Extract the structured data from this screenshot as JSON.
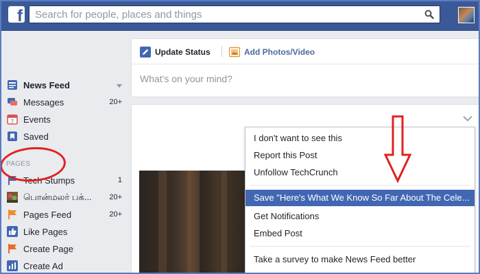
{
  "topbar": {
    "logo_letter": "f",
    "search_placeholder": "Search for people, places and things"
  },
  "leftnav": {
    "items": [
      {
        "label": "News Feed",
        "count": ""
      },
      {
        "label": "Messages",
        "count": "20+"
      },
      {
        "label": "Events",
        "count": ""
      },
      {
        "label": "Saved",
        "count": ""
      }
    ],
    "section_title": "PAGES",
    "pages": [
      {
        "label": "Tech Stumps",
        "count": "1"
      },
      {
        "label": "பொன்மலர் பக்...",
        "count": "20+"
      },
      {
        "label": "Pages Feed",
        "count": "20+"
      },
      {
        "label": "Like Pages",
        "count": ""
      },
      {
        "label": "Create Page",
        "count": ""
      },
      {
        "label": "Create Ad",
        "count": ""
      }
    ]
  },
  "composer": {
    "tab_update": "Update Status",
    "tab_photo": "Add Photos/Video",
    "placeholder": "What's on your mind?"
  },
  "menu": {
    "items": [
      "I don't want to see this",
      "Report this Post",
      "Unfollow TechCrunch",
      "Save \"Here's What We Know So Far About The Cele...",
      "Get Notifications",
      "Embed Post",
      "Take a survey to make News Feed better"
    ]
  },
  "colors": {
    "brand": "#3b5998",
    "highlight": "#4267b2",
    "annotation": "#e02020"
  }
}
